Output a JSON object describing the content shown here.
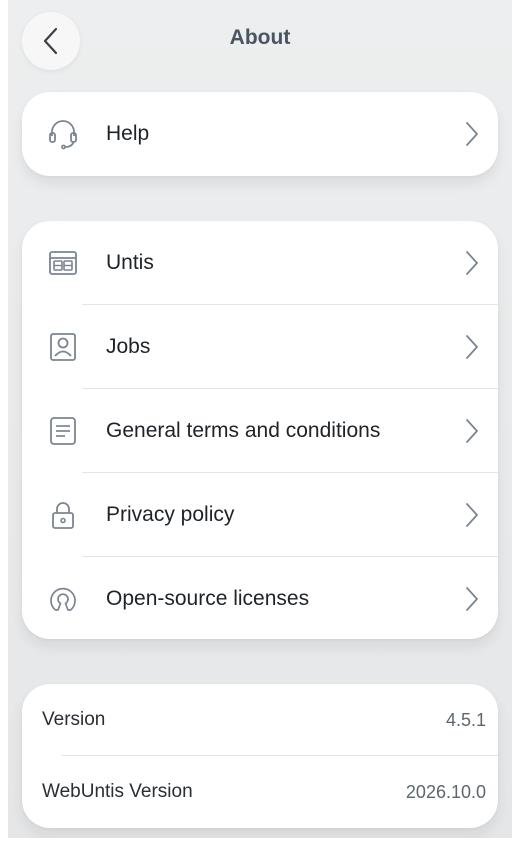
{
  "header": {
    "title": "About",
    "back_icon": "chevron-left-icon"
  },
  "help": {
    "label": "Help",
    "icon": "headset-icon"
  },
  "menu": {
    "items": [
      {
        "label": "Untis",
        "icon": "timetable-icon"
      },
      {
        "label": "Jobs",
        "icon": "person-badge-icon"
      },
      {
        "label": "General terms and conditions",
        "icon": "document-icon"
      },
      {
        "label": "Privacy policy",
        "icon": "lock-icon"
      },
      {
        "label": "Open-source licenses",
        "icon": "open-source-icon"
      }
    ]
  },
  "version_info": {
    "rows": [
      {
        "label": "Version",
        "value": "4.5.1"
      },
      {
        "label": "WebUntis Version",
        "value": "2026.10.0"
      }
    ]
  },
  "colors": {
    "background": "#eceeef",
    "card": "#ffffff",
    "icon_stroke": "#7a8592",
    "title": "#4b5560"
  }
}
